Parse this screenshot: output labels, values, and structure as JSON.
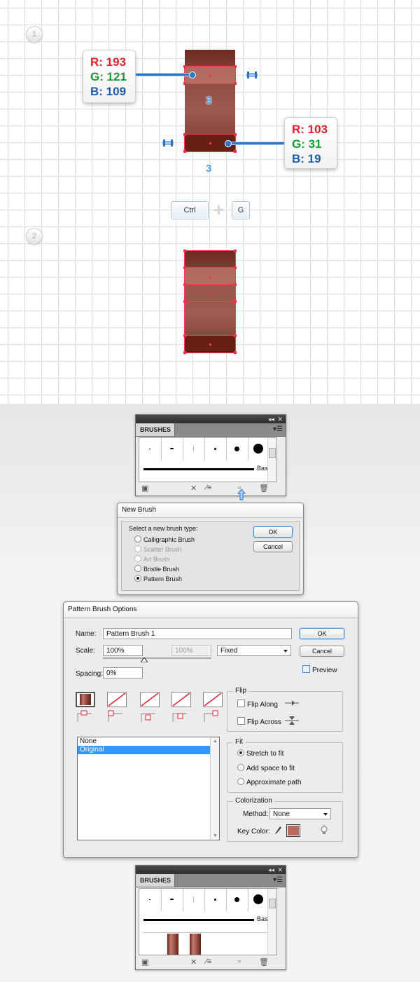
{
  "steps": [
    "1",
    "2"
  ],
  "callout_left": {
    "r": "R: 193",
    "g": "G: 121",
    "b": "B: 109"
  },
  "callout_right": {
    "r": "R: 103",
    "g": "G: 31",
    "b": "B: 19"
  },
  "dimension_labels": {
    "inner": "3",
    "bottom": "3"
  },
  "shortcut": {
    "key1": "Ctrl",
    "plus": "+",
    "key2": "G"
  },
  "colors": {
    "light_red": "#c1796d",
    "dark_red": "#671f13",
    "selection": "#ff3048",
    "leader": "#2c74c4"
  },
  "brushes_panel": {
    "tab": "BRUSHES",
    "collapse": "◂◂",
    "close": "✕",
    "menu": "▾☰",
    "basic_label": "Basic"
  },
  "new_brush": {
    "title": "New Brush",
    "prompt": "Select a new brush type:",
    "types": [
      "Calligraphic Brush",
      "Scatter Brush",
      "Art Brush",
      "Bristle Brush",
      "Pattern Brush"
    ],
    "ok": "OK",
    "cancel": "Cancel"
  },
  "pattern_options": {
    "title": "Pattern Brush Options",
    "name_label": "Name:",
    "name_value": "Pattern Brush 1",
    "scale_label": "Scale:",
    "scale_value": "100%",
    "scale_value2": "100%",
    "scale_mode": "Fixed",
    "spacing_label": "Spacing:",
    "spacing_value": "0%",
    "ok": "OK",
    "cancel": "Cancel",
    "preview": "Preview",
    "tiles_list": [
      "None",
      "Original"
    ],
    "flip_title": "Flip",
    "flip_along": "Flip Along",
    "flip_across": "Flip Across",
    "fit_title": "Fit",
    "fit_options": [
      "Stretch to fit",
      "Add space to fit",
      "Approximate path"
    ],
    "colorization_title": "Colorization",
    "method_label": "Method:",
    "method_value": "None",
    "key_color_label": "Key Color:"
  }
}
